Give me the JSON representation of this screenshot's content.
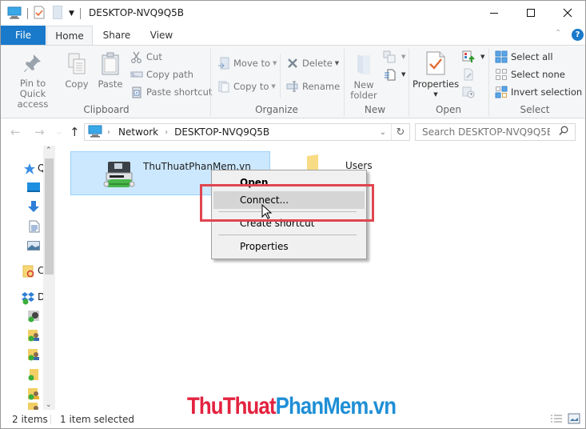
{
  "window": {
    "title": "DESKTOP-NVQ9Q5B",
    "minimize_label": "Minimize",
    "maximize_label": "Maximize",
    "close_label": "Close",
    "help_label": "?"
  },
  "tabs": [
    {
      "label": "File",
      "active": false
    },
    {
      "label": "Home",
      "active": true
    },
    {
      "label": "Share",
      "active": false
    },
    {
      "label": "View",
      "active": false
    }
  ],
  "ribbon": {
    "clipboard": {
      "label": "Clipboard",
      "pin_label_1": "Pin to Quick",
      "pin_label_2": "access",
      "copy": "Copy",
      "paste": "Paste",
      "cut": "Cut",
      "copy_path": "Copy path",
      "paste_shortcut": "Paste shortcut"
    },
    "organize": {
      "label": "Organize",
      "move_to": "Move to",
      "copy_to": "Copy to",
      "delete": "Delete",
      "rename": "Rename"
    },
    "new": {
      "label": "New",
      "new_folder_1": "New",
      "new_folder_2": "folder"
    },
    "open": {
      "label": "Open",
      "properties": "Properties"
    },
    "select": {
      "label": "Select",
      "select_all": "Select all",
      "select_none": "Select none",
      "invert_selection": "Invert selection"
    }
  },
  "address": {
    "crumbs": [
      "Network",
      "DESKTOP-NVQ9Q5B"
    ],
    "search_placeholder": "Search DESKTOP-NVQ9Q5B"
  },
  "navpane": {
    "items": [
      {
        "icon": "quick-access-star",
        "label": "Q"
      },
      {
        "icon": "desktop",
        "label": ""
      },
      {
        "icon": "downloads",
        "label": ""
      },
      {
        "icon": "documents",
        "label": ""
      },
      {
        "icon": "pictures",
        "label": ""
      },
      {
        "icon": "creative-cloud",
        "label": "C"
      },
      {
        "icon": "dropbox",
        "label": "D"
      }
    ]
  },
  "content": {
    "items": [
      {
        "name": "ThuThuatPhanMem.vn",
        "type": "printer",
        "selected": true
      },
      {
        "name": "Users",
        "type": "folder",
        "selected": false
      }
    ]
  },
  "context_menu": {
    "items": [
      {
        "label": "Open",
        "bold": true
      },
      {
        "label": "Connect...",
        "hover": true
      },
      {
        "label": "Create shortcut"
      },
      {
        "label": "Properties"
      }
    ]
  },
  "status": {
    "count": "2 items",
    "selection": "1 item selected"
  },
  "watermark": {
    "part1": "ThuThuat",
    "part2": "PhanMem.vn",
    "color1": "#e3233f",
    "color2": "#1f8fd6"
  },
  "colors": {
    "file_tab": "#1979ca",
    "selection_bg": "#cce8ff",
    "selection_border": "#99d1ff",
    "highlight_box": "#e0454f"
  }
}
